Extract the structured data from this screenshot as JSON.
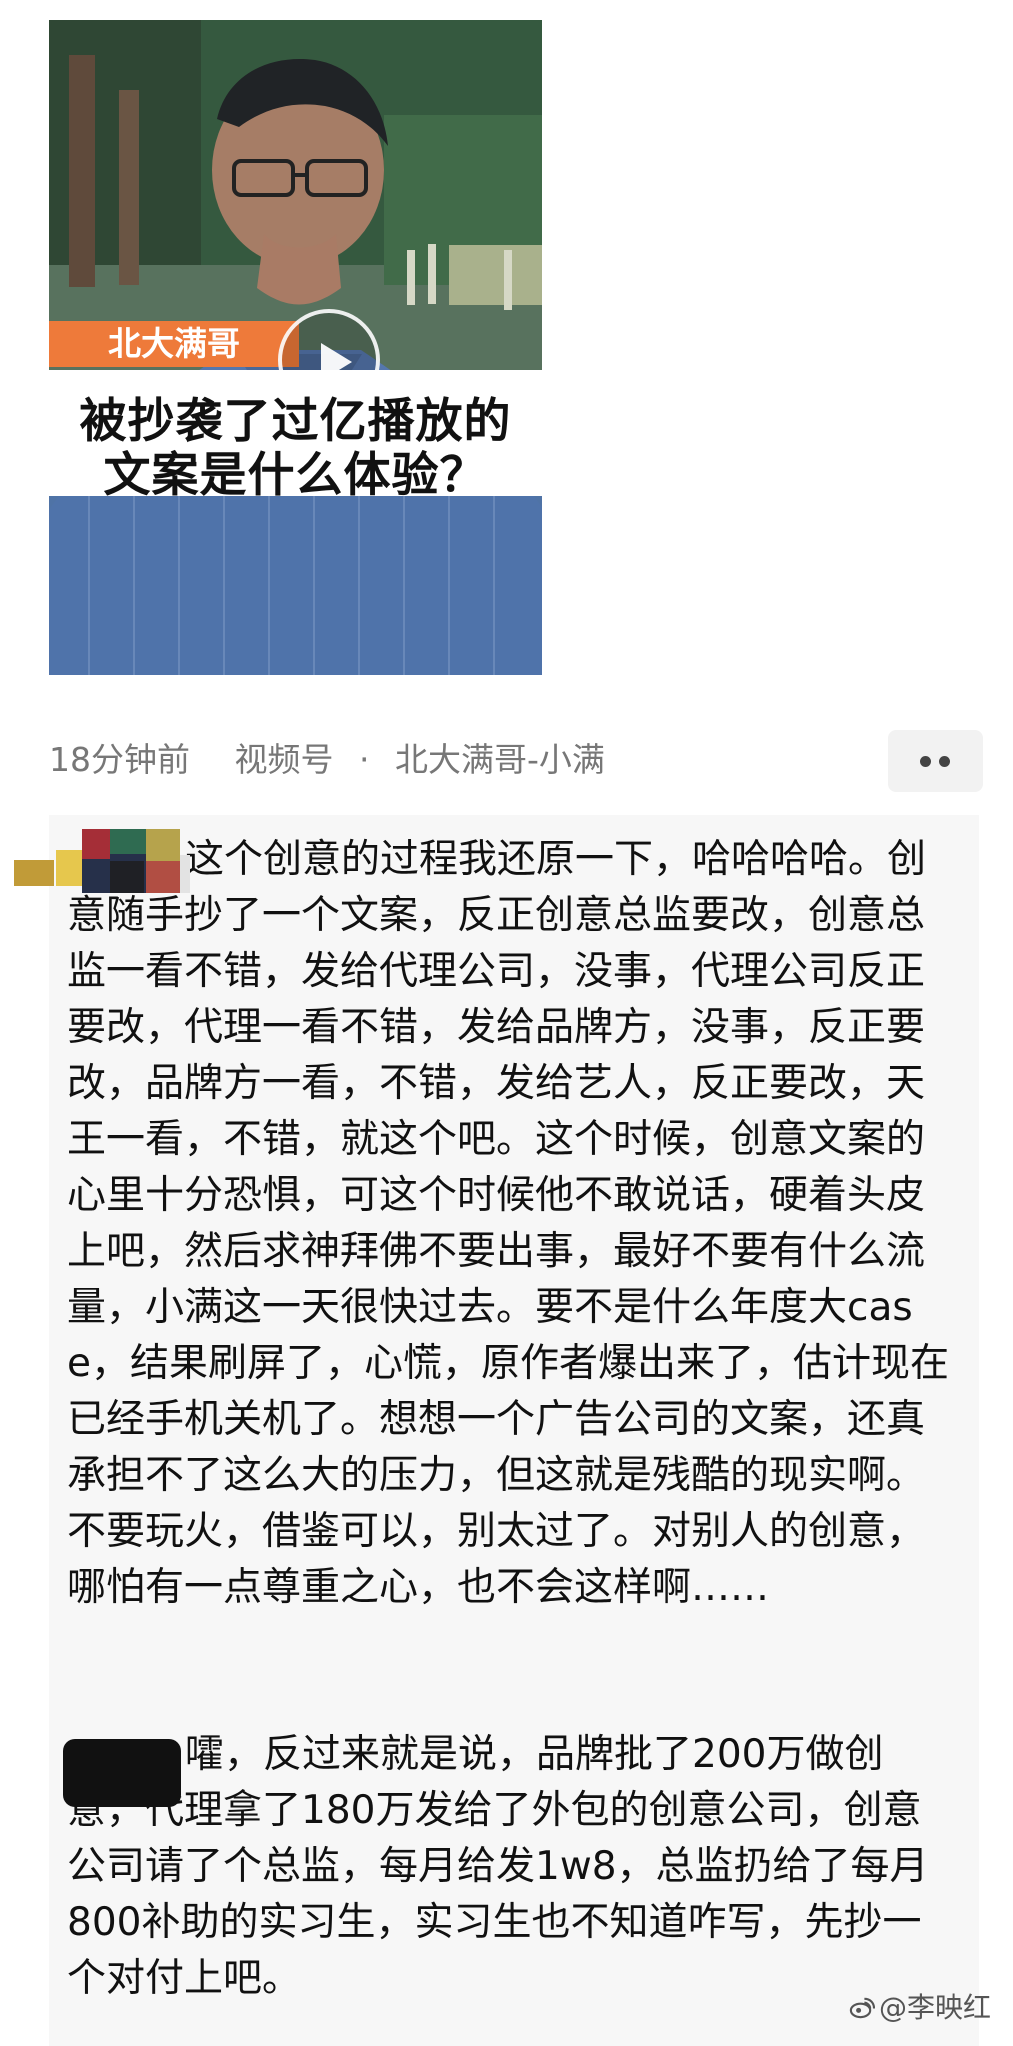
{
  "video": {
    "tag": "北大满哥",
    "caption_line1": "被抄袭了过亿播放的",
    "caption_line2": "文案是什么体验？"
  },
  "meta": {
    "time": "18分钟前",
    "source": "视频号",
    "separator": "·",
    "author": "北大满哥-小满"
  },
  "comments": [
    {
      "text": "这个创意的过程我还原一下，哈哈哈哈。创意随手抄了一个文案，反正创意总监要改，创意总监一看不错，发给代理公司，没事，代理公司反正要改，代理一看不错，发给品牌方，没事，反正要改，品牌方一看，不错，发给艺人，反正要改，天王一看，不错，就这个吧。这个时候，创意文案的心里十分恐惧，可这个时候他不敢说话，硬着头皮上吧，然后求神拜佛不要出事，最好不要有什么流量，小满这一天很快过去。要不是什么年度大case，结果刷屏了，心慌，原作者爆出来了，估计现在已经手机关机了。想想一个广告公司的文案，还真承担不了这么大的压力，但这就是残酷的现实啊。不要玩火，借鉴可以，别太过了。对别人的创意，哪怕有一点尊重之心，也不会这样啊……"
    },
    {
      "text": "嚯，反过来就是说，品牌批了200万做创意，代理拿了180万发给了外包的创意公司，创意公司请了个总监，每月给发1w8，总监扔给了每月800补助的实习生，实习生也不知道咋写，先抄一个对付上吧。"
    }
  ],
  "watermark": {
    "text": "@李映红"
  },
  "icons": {
    "play": "play-icon",
    "more": "more-icon",
    "weibo": "weibo-icon"
  },
  "colors": {
    "tag_background": "#ee7a3a",
    "meta_text": "#777777",
    "comment_background": "#f7f7f7"
  }
}
